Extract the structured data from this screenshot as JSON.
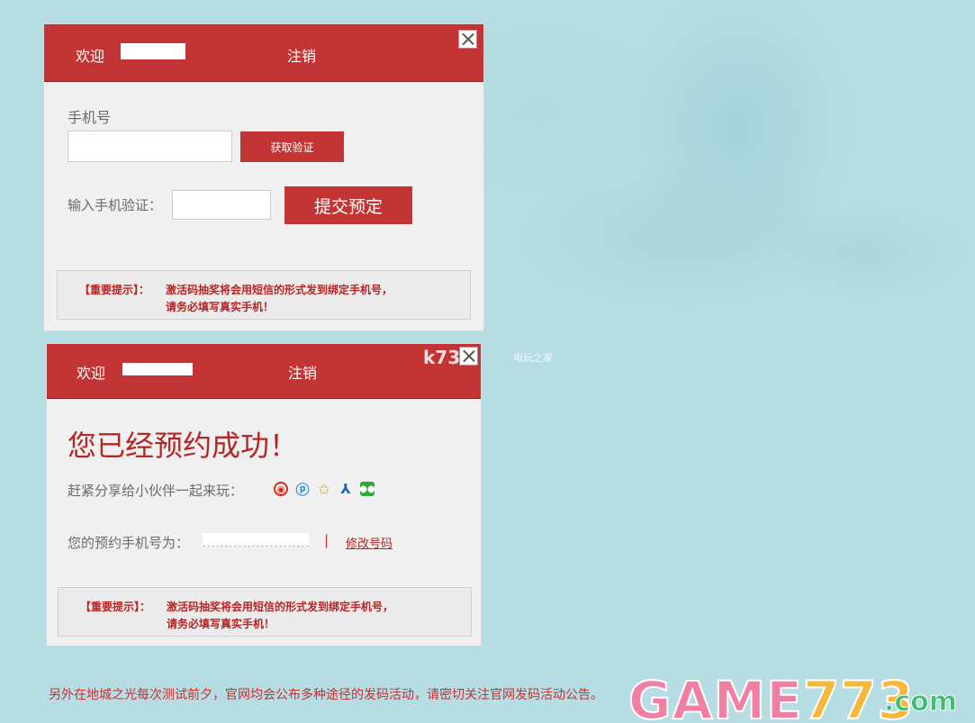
{
  "panel1": {
    "welcome": "欢迎",
    "logout": "注销",
    "phone_label": "手机号",
    "phone_value": "",
    "get_code_button": "获取验证",
    "code_label": "输入手机验证：",
    "code_value": "",
    "submit_button": "提交预定",
    "notice_tag": "【重要提示】：",
    "notice_line1": "激活码抽奖将会用短信的形式发到绑定手机号，",
    "notice_line2": "请务必填写真实手机！"
  },
  "panel2": {
    "welcome": "欢迎",
    "logout": "注销",
    "success_title": "您已经预约成功！",
    "share_label": "赶紧分享给小伙伴一起来玩：",
    "share_icons": [
      "weibo-icon",
      "p-icon",
      "star-icon",
      "renren-icon",
      "wechat-icon"
    ],
    "phone_row_label": "您的预约手机号为：",
    "divider": "|",
    "modify_link": "修改号码",
    "notice_tag": "【重要提示】：",
    "notice_line1": "激活码抽奖将会用短信的形式发到绑定手机号，",
    "notice_line2": "请务必填写真实手机！"
  },
  "bottom_text": "另外在地城之光每次测试前夕，官网均会公布多种途径的发码活动，请密切关注官网发码活动公告。",
  "watermarks": {
    "k73": "k73",
    "k73_sub": "电玩之家",
    "game_text": "GAME",
    "game_num": "773",
    "game_com": ".com"
  },
  "colors": {
    "header_red": "#c33434",
    "text_red": "#b52626",
    "panel_bg": "#f0f0f0",
    "page_bg": "#b5dde3"
  }
}
